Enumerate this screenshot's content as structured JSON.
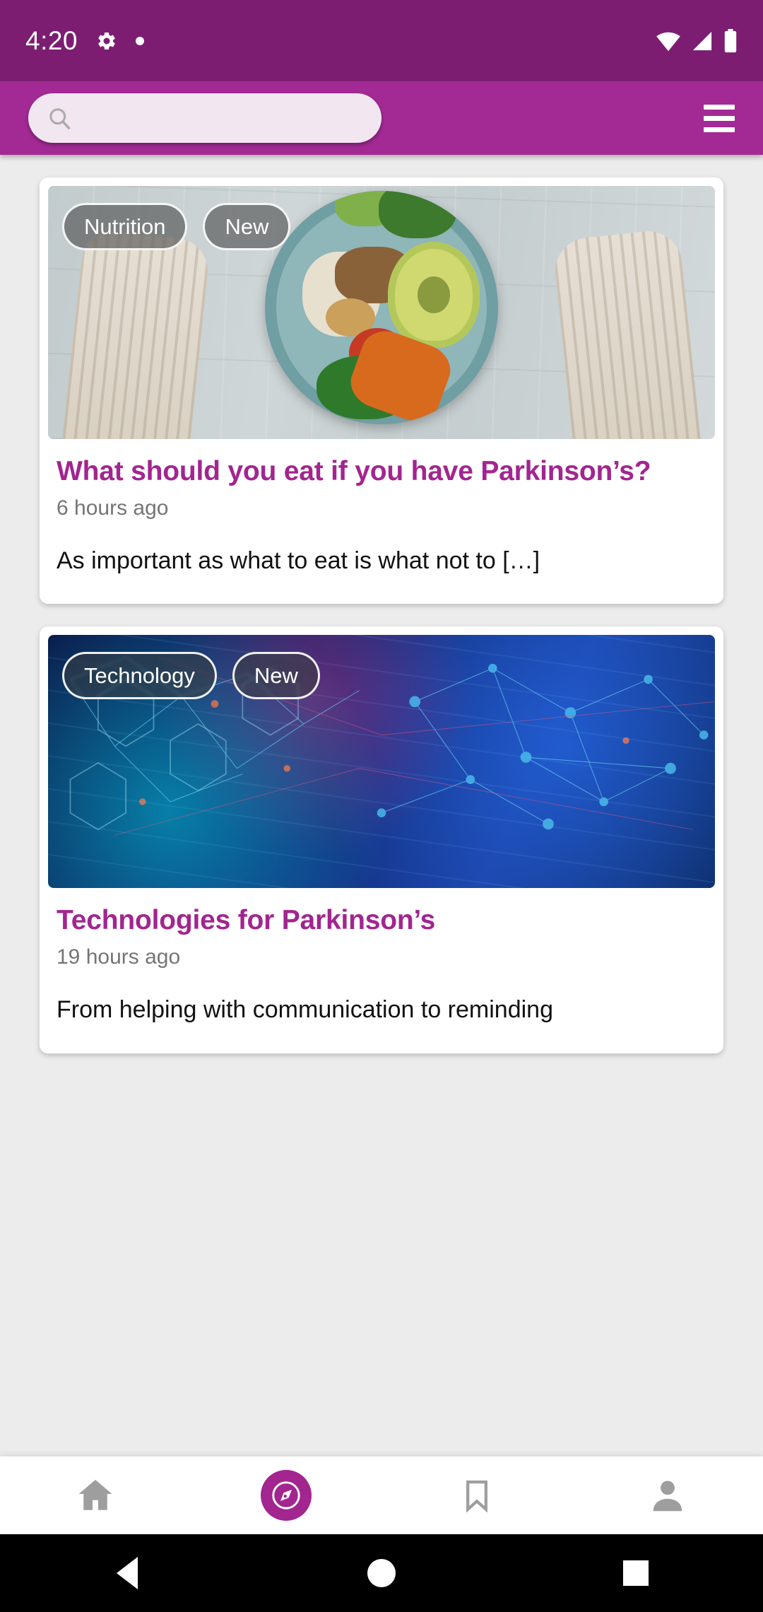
{
  "status_bar": {
    "time": "4:20",
    "icons_left": [
      "gear-icon",
      "dot-indicator"
    ],
    "icons_right": [
      "wifi-icon",
      "signal-icon",
      "battery-icon"
    ],
    "background_color": "#7C1D72"
  },
  "app_bar": {
    "background_color": "#A32A95",
    "search": {
      "value": "",
      "placeholder": "",
      "icon": "search-icon"
    },
    "menu": {
      "icon": "hamburger-menu-icon",
      "label": "Menu"
    }
  },
  "feed": {
    "cards": [
      {
        "tags": [
          "Nutrition",
          "New"
        ],
        "image": "food-bowl-photo",
        "title": "What should you eat if you have Parkinson’s?",
        "time": "6 hours ago",
        "excerpt": "As important as what to eat is what not to […]"
      },
      {
        "tags": [
          "Technology",
          "New"
        ],
        "image": "technology-network-photo",
        "title": "Technologies for Parkinson’s",
        "time": "19 hours ago",
        "excerpt": "From helping with communication to reminding"
      }
    ]
  },
  "bottom_nav": {
    "items": [
      {
        "name": "home",
        "icon": "home-icon",
        "active": false
      },
      {
        "name": "explore",
        "icon": "compass-icon",
        "active": true
      },
      {
        "name": "bookmarks",
        "icon": "bookmark-icon",
        "active": false
      },
      {
        "name": "profile",
        "icon": "person-icon",
        "active": false
      }
    ],
    "active_color": "#A22590",
    "inactive_color": "#9E9E9E"
  },
  "system_nav": {
    "buttons": [
      "back-button",
      "home-button",
      "recents-button"
    ],
    "background_color": "#000000"
  },
  "theme": {
    "primary": "#A32A95",
    "primary_dark": "#7C1D72",
    "title_color": "#A22590",
    "page_background": "#ECECEC"
  }
}
